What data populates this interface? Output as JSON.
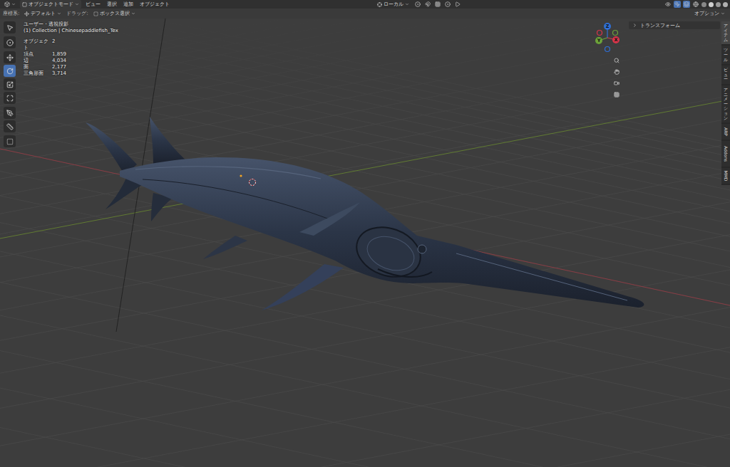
{
  "header": {
    "mode": "オブジェクトモード",
    "menus": [
      "ビュー",
      "選択",
      "追加",
      "オブジェクト"
    ],
    "orientation": "ローカル"
  },
  "tool_settings": {
    "orientation_label": "座標系:",
    "orientation": "デフォルト",
    "drag_label": "ドラッグ:",
    "drag": "ボックス選択",
    "options": "オプション"
  },
  "tools": [
    {
      "selected": false
    },
    {
      "selected": false
    },
    {
      "selected": false
    },
    {
      "selected": true
    },
    {
      "selected": false
    },
    {
      "selected": false
    },
    {
      "selected": false
    },
    {
      "selected": false
    },
    {
      "selected": false
    }
  ],
  "viewport": {
    "view_name": "ユーザー・透視投影",
    "collection": "(1) Collection | Chinesepaddlefish_Tex",
    "stats": [
      {
        "label": "オブジェクト",
        "value": "2"
      },
      {
        "label": "頂点",
        "value": "1,859"
      },
      {
        "label": "辺",
        "value": "4,034"
      },
      {
        "label": "面",
        "value": "2,177"
      },
      {
        "label": "三角形面",
        "value": "3,714"
      }
    ]
  },
  "gizmo": {
    "axes": [
      {
        "label": "Z",
        "color": "#2f6fd6"
      },
      {
        "label": "Y",
        "color": "#6ba23a"
      },
      {
        "label": "X",
        "color": "#d8354a"
      }
    ]
  },
  "sidebar": {
    "panel": "トランスフォーム",
    "expanded": false,
    "tabs": [
      {
        "label": "アイテム",
        "selected": true,
        "kind": "vertical"
      },
      {
        "label": "ツール",
        "selected": false,
        "kind": "vertical"
      },
      {
        "label": "ビュー",
        "selected": false,
        "kind": "vertical"
      },
      {
        "label": "アニメーション",
        "selected": false,
        "kind": "vertical"
      },
      {
        "label": "ARP",
        "selected": false,
        "kind": "rotated"
      },
      {
        "label": "Addons",
        "selected": false,
        "kind": "rotated"
      },
      {
        "label": "MMD",
        "selected": false,
        "kind": "rotated"
      }
    ]
  }
}
